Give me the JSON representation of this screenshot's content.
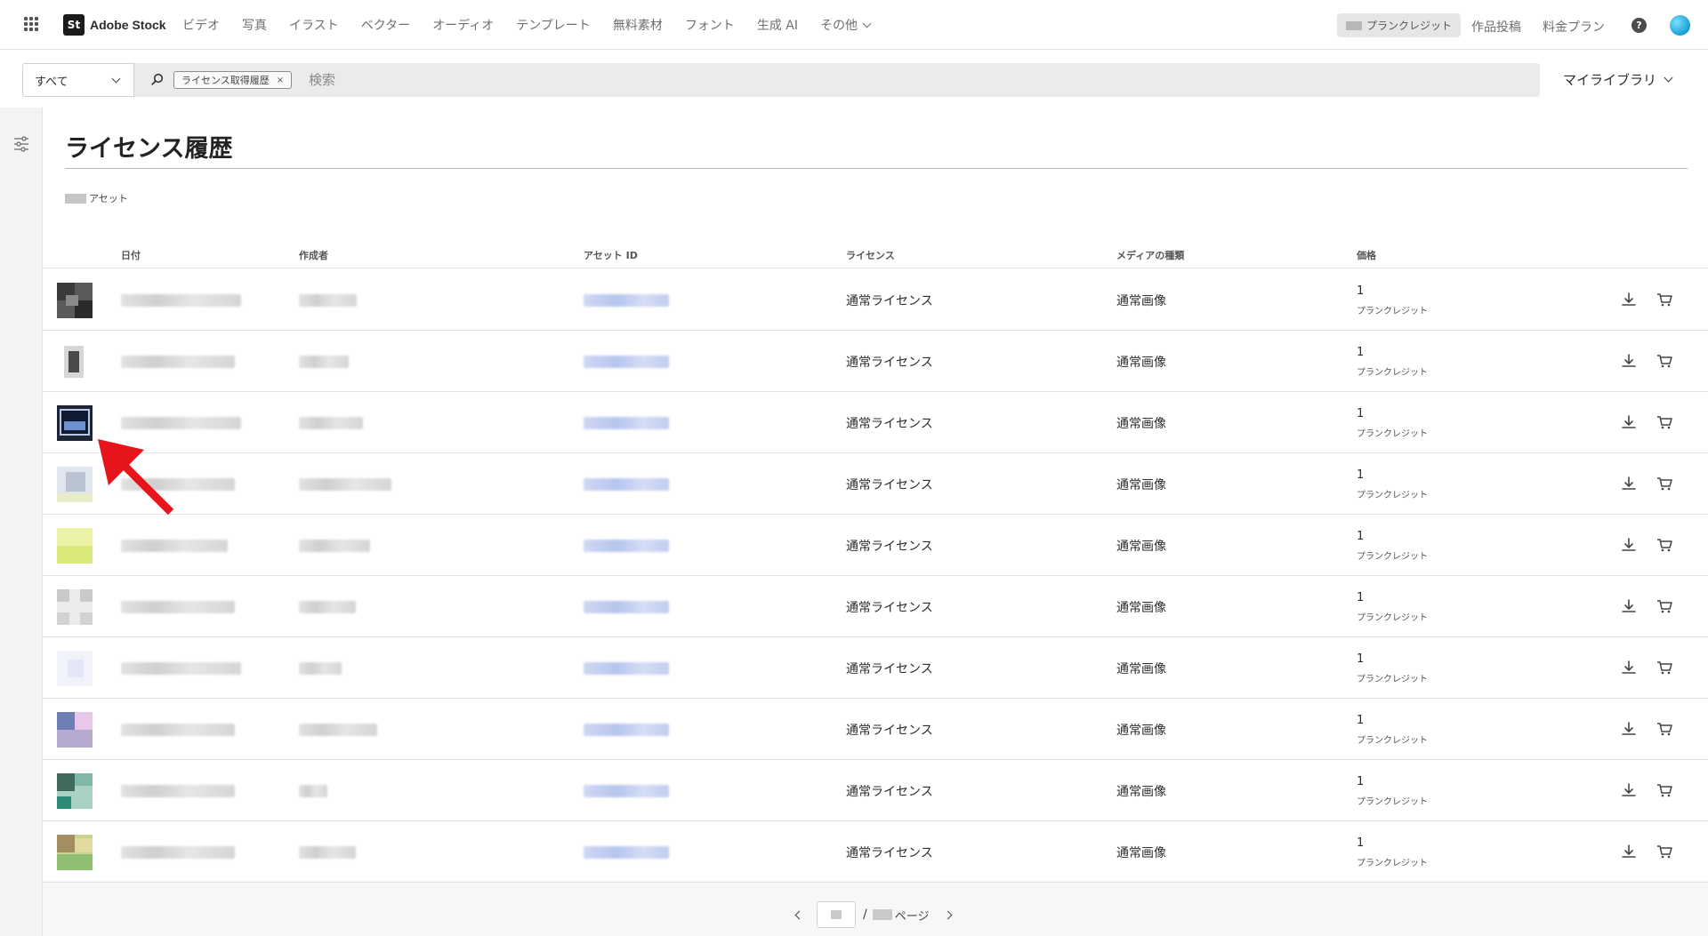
{
  "nav": {
    "logo_mark": "St",
    "logo_text": "Adobe Stock",
    "items": [
      "ビデオ",
      "写真",
      "イラスト",
      "ベクター",
      "オーディオ",
      "テンプレート",
      "無料素材",
      "フォント",
      "生成 AI",
      "その他"
    ],
    "credits_label": "プランクレジット",
    "contribute": "作品投稿",
    "pricing": "料金プラン",
    "help_glyph": "?"
  },
  "search": {
    "scope": "すべて",
    "chip_label": "ライセンス取得履歴",
    "chip_close": "×",
    "placeholder": "検索",
    "library": "マイライブラリ"
  },
  "page": {
    "title": "ライセンス履歴",
    "asset_count_suffix": "アセット"
  },
  "table": {
    "headers": {
      "date": "日付",
      "author": "作成者",
      "asset_id": "アセット ID",
      "license": "ライセンス",
      "media": "メディアの種類",
      "price": "価格"
    },
    "rows": [
      {
        "license": "通常ライセンス",
        "media": "通常画像",
        "price": "1",
        "unit": "プランクレジット"
      },
      {
        "license": "通常ライセンス",
        "media": "通常画像",
        "price": "1",
        "unit": "プランクレジット"
      },
      {
        "license": "通常ライセンス",
        "media": "通常画像",
        "price": "1",
        "unit": "プランクレジット"
      },
      {
        "license": "通常ライセンス",
        "media": "通常画像",
        "price": "1",
        "unit": "プランクレジット"
      },
      {
        "license": "通常ライセンス",
        "media": "通常画像",
        "price": "1",
        "unit": "プランクレジット"
      },
      {
        "license": "通常ライセンス",
        "media": "通常画像",
        "price": "1",
        "unit": "プランクレジット"
      },
      {
        "license": "通常ライセンス",
        "media": "通常画像",
        "price": "1",
        "unit": "プランクレジット"
      },
      {
        "license": "通常ライセンス",
        "media": "通常画像",
        "price": "1",
        "unit": "プランクレジット"
      },
      {
        "license": "通常ライセンス",
        "media": "通常画像",
        "price": "1",
        "unit": "プランクレジット"
      },
      {
        "license": "通常ライセンス",
        "media": "通常画像",
        "price": "1",
        "unit": "プランクレジット"
      }
    ]
  },
  "pagination": {
    "separator": "/",
    "page_label": "ページ"
  },
  "colors": {
    "annotation_arrow": "#e8141b",
    "avatar": "#149fd6",
    "chip_border": "#8e8e8e"
  }
}
